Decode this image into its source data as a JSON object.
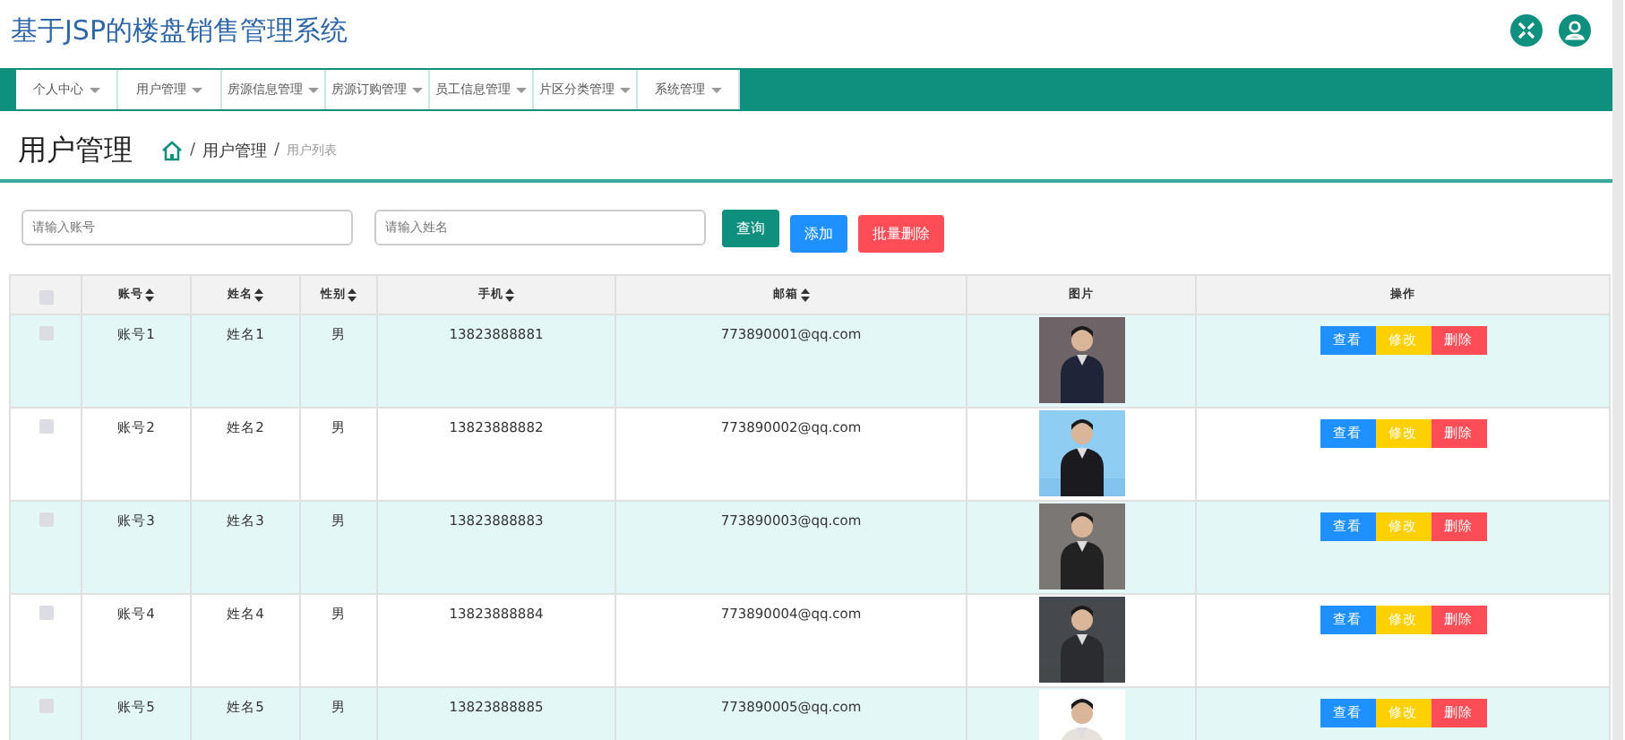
{
  "header": {
    "title": "基于JSP的楼盘销售管理系统"
  },
  "nav": [
    {
      "label": "个人中心",
      "selected": false
    },
    {
      "label": "用户管理",
      "selected": false
    },
    {
      "label": "房源信息管理",
      "selected": false
    },
    {
      "label": "房源订购管理",
      "selected": false
    },
    {
      "label": "员工信息管理",
      "selected": false
    },
    {
      "label": "片区分类管理",
      "selected": false
    },
    {
      "label": "系统管理",
      "selected": false
    }
  ],
  "page": {
    "heading": "用户管理",
    "breadcrumb": [
      {
        "separator": "/",
        "label": "用户管理"
      },
      {
        "separator": "/",
        "label": "用户列表"
      }
    ]
  },
  "search": {
    "fields": [
      {
        "placeholder": "请输入账号"
      },
      {
        "placeholder": "请输入姓名"
      }
    ],
    "buttons": [
      {
        "label": "查询",
        "kind": "search"
      },
      {
        "label": "添加",
        "kind": "add"
      },
      {
        "label": "批量删除",
        "kind": "delete"
      }
    ]
  },
  "table": {
    "columns": [
      {
        "kind": "check",
        "checked": false
      },
      {
        "label": "账号",
        "kind": "text",
        "sortable": true
      },
      {
        "label": "姓名",
        "kind": "text",
        "sortable": true
      },
      {
        "label": "性别",
        "kind": "text",
        "sortable": true
      },
      {
        "label": "手机",
        "kind": "text",
        "sortable": true
      },
      {
        "label": "邮箱",
        "kind": "text",
        "sortable": true
      },
      {
        "label": "图片",
        "sortable": false
      },
      {
        "label": "操作",
        "kind": "actions",
        "sortable": false
      }
    ],
    "rows": [
      {
        "cells": [
          {
            "checked": false
          },
          {
            "text": "账号1"
          },
          {
            "text": "姓名1"
          },
          {
            "text": "男"
          },
          {
            "text": "13823888881"
          },
          {
            "text": "773890001@qq.com"
          },
          {
            "kind": "picture"
          },
          {
            "actions": [
              "查看",
              "修改",
              "删除"
            ]
          }
        ]
      },
      {
        "cells": [
          {
            "checked": false
          },
          {
            "text": "账号2"
          },
          {
            "text": "姓名2"
          },
          {
            "text": "男"
          },
          {
            "text": "13823888882"
          },
          {
            "text": "773890002@qq.com"
          },
          {
            "kind": "picture"
          },
          {
            "actions": [
              "查看",
              "修改",
              "删除"
            ]
          }
        ]
      },
      {
        "cells": [
          {
            "checked": false
          },
          {
            "text": "账号3"
          },
          {
            "text": "姓名3"
          },
          {
            "text": "男"
          },
          {
            "text": "13823888883"
          },
          {
            "text": "773890003@qq.com"
          },
          {
            "kind": "picture"
          },
          {
            "actions": [
              "查看",
              "修改",
              "删除"
            ]
          }
        ]
      },
      {
        "cells": [
          {
            "checked": false
          },
          {
            "text": "账号4"
          },
          {
            "text": "姓名4"
          },
          {
            "text": "男"
          },
          {
            "text": "13823888884"
          },
          {
            "text": "773890004@qq.com"
          },
          {
            "kind": "picture"
          },
          {
            "actions": [
              "查看",
              "修改",
              "删除"
            ]
          }
        ]
      },
      {
        "cells": [
          {
            "checked": false
          },
          {
            "text": "账号5"
          },
          {
            "text": "姓名5"
          },
          {
            "text": "男"
          },
          {
            "text": "13823888885"
          },
          {
            "text": "773890005@qq.com"
          },
          {
            "kind": "picture"
          },
          {
            "actions": [
              "查看",
              "修改",
              "删除"
            ]
          }
        ]
      }
    ]
  }
}
